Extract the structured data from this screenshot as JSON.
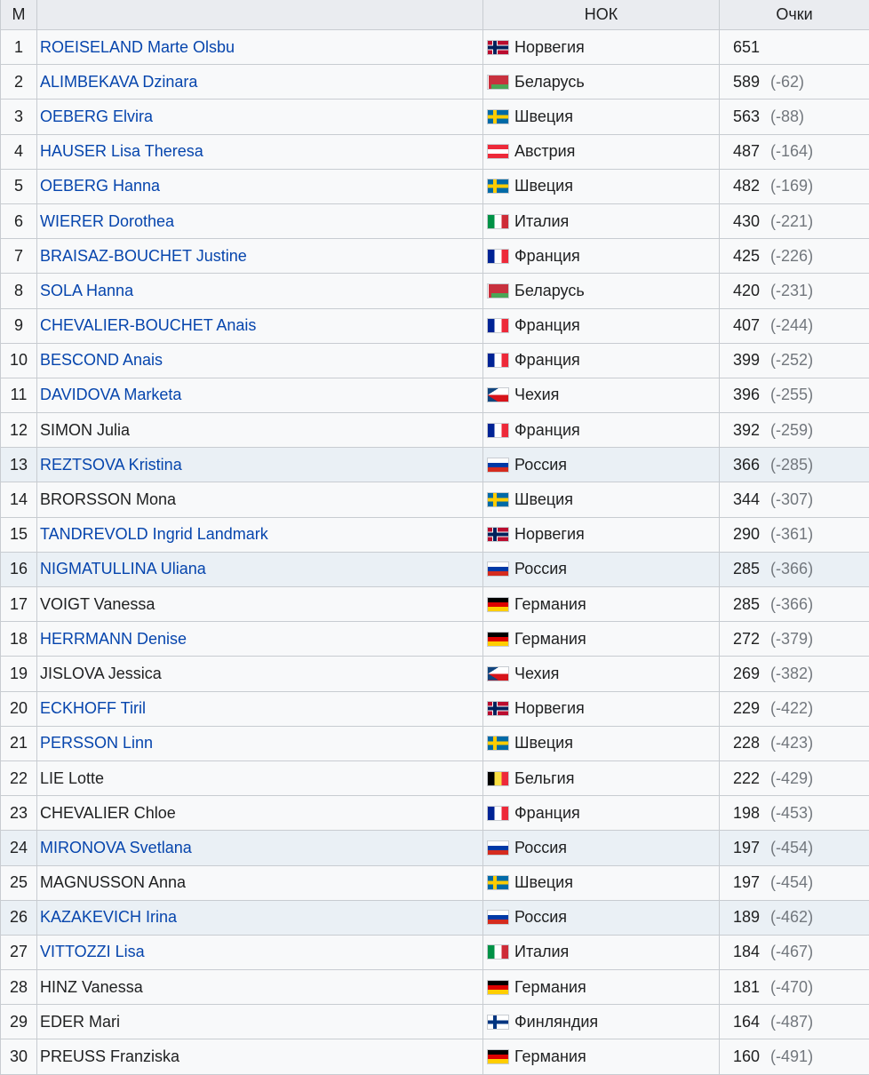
{
  "table": {
    "headers": {
      "pos": "М",
      "name": "",
      "noc": "НОК",
      "points": "Очки"
    },
    "rows": [
      {
        "pos": "1",
        "name": "ROEISELAND Marte Olsbu",
        "link": true,
        "highlight": false,
        "flag": "nor",
        "country": "Норвегия",
        "points": "651",
        "diff": ""
      },
      {
        "pos": "2",
        "name": "ALIMBEKAVA Dzinara",
        "link": true,
        "highlight": false,
        "flag": "blr",
        "country": "Беларусь",
        "points": "589",
        "diff": "(-62)"
      },
      {
        "pos": "3",
        "name": "OEBERG Elvira",
        "link": true,
        "highlight": false,
        "flag": "swe",
        "country": "Швеция",
        "points": "563",
        "diff": "(-88)"
      },
      {
        "pos": "4",
        "name": "HAUSER Lisa Theresa",
        "link": true,
        "highlight": false,
        "flag": "aut",
        "country": "Австрия",
        "points": "487",
        "diff": "(-164)"
      },
      {
        "pos": "5",
        "name": "OEBERG Hanna",
        "link": true,
        "highlight": false,
        "flag": "swe",
        "country": "Швеция",
        "points": "482",
        "diff": "(-169)"
      },
      {
        "pos": "6",
        "name": "WIERER Dorothea",
        "link": true,
        "highlight": false,
        "flag": "ita",
        "country": "Италия",
        "points": "430",
        "diff": "(-221)"
      },
      {
        "pos": "7",
        "name": "BRAISAZ-BOUCHET Justine",
        "link": true,
        "highlight": false,
        "flag": "fra",
        "country": "Франция",
        "points": "425",
        "diff": "(-226)"
      },
      {
        "pos": "8",
        "name": "SOLA Hanna",
        "link": true,
        "highlight": false,
        "flag": "blr",
        "country": "Беларусь",
        "points": "420",
        "diff": "(-231)"
      },
      {
        "pos": "9",
        "name": "CHEVALIER-BOUCHET Anais",
        "link": true,
        "highlight": false,
        "flag": "fra",
        "country": "Франция",
        "points": "407",
        "diff": "(-244)"
      },
      {
        "pos": "10",
        "name": "BESCOND Anais",
        "link": true,
        "highlight": false,
        "flag": "fra",
        "country": "Франция",
        "points": "399",
        "diff": "(-252)"
      },
      {
        "pos": "11",
        "name": "DAVIDOVA Marketa",
        "link": true,
        "highlight": false,
        "flag": "cze",
        "country": "Чехия",
        "points": "396",
        "diff": "(-255)"
      },
      {
        "pos": "12",
        "name": "SIMON Julia",
        "link": false,
        "highlight": false,
        "flag": "fra",
        "country": "Франция",
        "points": "392",
        "diff": "(-259)"
      },
      {
        "pos": "13",
        "name": "REZTSOVA Kristina",
        "link": true,
        "highlight": true,
        "flag": "rus",
        "country": "Россия",
        "points": "366",
        "diff": "(-285)"
      },
      {
        "pos": "14",
        "name": "BRORSSON Mona",
        "link": false,
        "highlight": false,
        "flag": "swe",
        "country": "Швеция",
        "points": "344",
        "diff": "(-307)"
      },
      {
        "pos": "15",
        "name": "TANDREVOLD Ingrid Landmark",
        "link": true,
        "highlight": false,
        "flag": "nor",
        "country": "Норвегия",
        "points": "290",
        "diff": "(-361)"
      },
      {
        "pos": "16",
        "name": "NIGMATULLINA Uliana",
        "link": true,
        "highlight": true,
        "flag": "rus",
        "country": "Россия",
        "points": "285",
        "diff": "(-366)"
      },
      {
        "pos": "17",
        "name": "VOIGT Vanessa",
        "link": false,
        "highlight": false,
        "flag": "ger",
        "country": "Германия",
        "points": "285",
        "diff": "(-366)"
      },
      {
        "pos": "18",
        "name": "HERRMANN Denise",
        "link": true,
        "highlight": false,
        "flag": "ger",
        "country": "Германия",
        "points": "272",
        "diff": "(-379)"
      },
      {
        "pos": "19",
        "name": "JISLOVA Jessica",
        "link": false,
        "highlight": false,
        "flag": "cze",
        "country": "Чехия",
        "points": "269",
        "diff": "(-382)"
      },
      {
        "pos": "20",
        "name": "ECKHOFF Tiril",
        "link": true,
        "highlight": false,
        "flag": "nor",
        "country": "Норвегия",
        "points": "229",
        "diff": "(-422)"
      },
      {
        "pos": "21",
        "name": "PERSSON Linn",
        "link": true,
        "highlight": false,
        "flag": "swe",
        "country": "Швеция",
        "points": "228",
        "diff": "(-423)"
      },
      {
        "pos": "22",
        "name": "LIE Lotte",
        "link": false,
        "highlight": false,
        "flag": "bel",
        "country": "Бельгия",
        "points": "222",
        "diff": "(-429)"
      },
      {
        "pos": "23",
        "name": "CHEVALIER Chloe",
        "link": false,
        "highlight": false,
        "flag": "fra",
        "country": "Франция",
        "points": "198",
        "diff": "(-453)"
      },
      {
        "pos": "24",
        "name": "MIRONOVA Svetlana",
        "link": true,
        "highlight": true,
        "flag": "rus",
        "country": "Россия",
        "points": "197",
        "diff": "(-454)"
      },
      {
        "pos": "25",
        "name": "MAGNUSSON Anna",
        "link": false,
        "highlight": false,
        "flag": "swe",
        "country": "Швеция",
        "points": "197",
        "diff": "(-454)"
      },
      {
        "pos": "26",
        "name": "KAZAKEVICH Irina",
        "link": true,
        "highlight": true,
        "flag": "rus",
        "country": "Россия",
        "points": "189",
        "diff": "(-462)"
      },
      {
        "pos": "27",
        "name": "VITTOZZI Lisa",
        "link": true,
        "highlight": false,
        "flag": "ita",
        "country": "Италия",
        "points": "184",
        "diff": "(-467)"
      },
      {
        "pos": "28",
        "name": "HINZ Vanessa",
        "link": false,
        "highlight": false,
        "flag": "ger",
        "country": "Германия",
        "points": "181",
        "diff": "(-470)"
      },
      {
        "pos": "29",
        "name": "EDER Mari",
        "link": false,
        "highlight": false,
        "flag": "fin",
        "country": "Финляндия",
        "points": "164",
        "diff": "(-487)"
      },
      {
        "pos": "30",
        "name": "PREUSS Franziska",
        "link": false,
        "highlight": false,
        "flag": "ger",
        "country": "Германия",
        "points": "160",
        "diff": "(-491)"
      }
    ]
  }
}
